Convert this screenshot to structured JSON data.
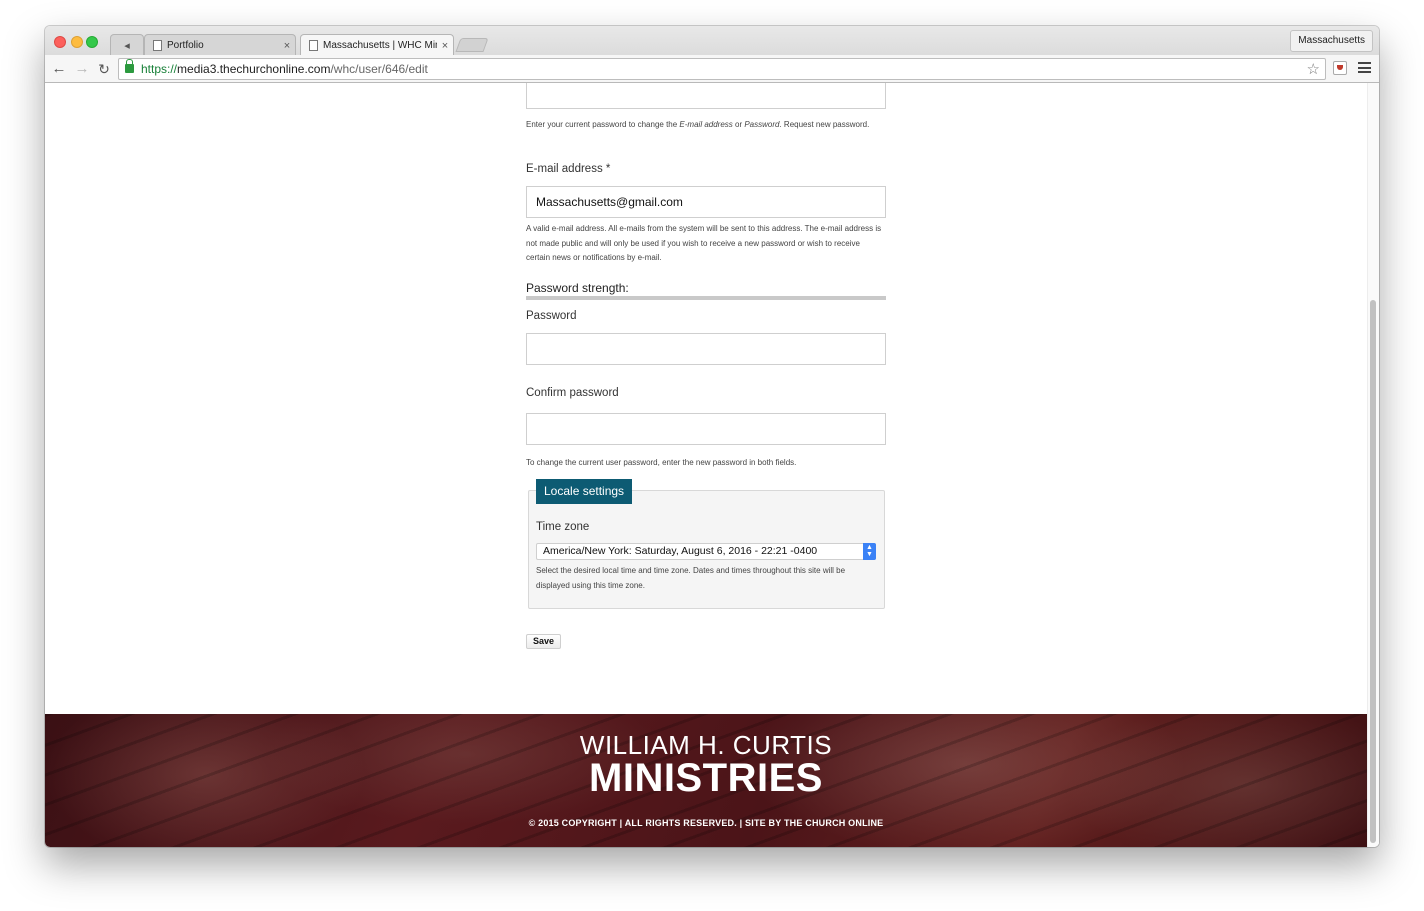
{
  "browser": {
    "tabs": [
      {
        "label": "Portfolio",
        "close": "×"
      },
      {
        "label": "Massachusetts | WHC Mini",
        "close": "×"
      }
    ],
    "mute_glyph": "◂",
    "profile_name": "Massachusetts",
    "url": {
      "scheme": "https://",
      "host": "media3.thechurchonline.com",
      "path": "/whc/user/646/edit"
    },
    "nav_glyphs": {
      "back": "←",
      "forward": "→",
      "reload": "↻",
      "star": "☆"
    }
  },
  "form": {
    "current_password_value": "",
    "current_password_help": {
      "pre": "Enter your current password to change the ",
      "em1": "E-mail address",
      "mid": " or ",
      "em2": "Password",
      "post": ". Request new password."
    },
    "email_label": "E-mail address *",
    "email_value": "Massachusetts@gmail.com",
    "email_help": "A valid e-mail address. All e-mails from the system will be sent to this address. The e-mail address is not made public and will only be used if you wish to receive a new password or wish to receive certain news or notifications by e-mail.",
    "strength_label": "Password strength:",
    "password_label": "Password",
    "password_value": "",
    "confirm_label": "Confirm password",
    "confirm_value": "",
    "password_help": "To change the current user password, enter the new password in both fields.",
    "locale_legend": "Locale settings",
    "timezone_label": "Time zone",
    "timezone_value": "America/New York: Saturday, August 6, 2016 - 22:21 -0400",
    "timezone_help": "Select the desired local time and time zone. Dates and times throughout this site will be displayed using this time zone.",
    "save_label": "Save"
  },
  "footer": {
    "line1": "WILLIAM H. CURTIS",
    "line2": "MINISTRIES",
    "copyright": "© 2015 COPYRIGHT | ALL RIGHTS RESERVED. | SITE BY THE CHURCH ONLINE"
  }
}
